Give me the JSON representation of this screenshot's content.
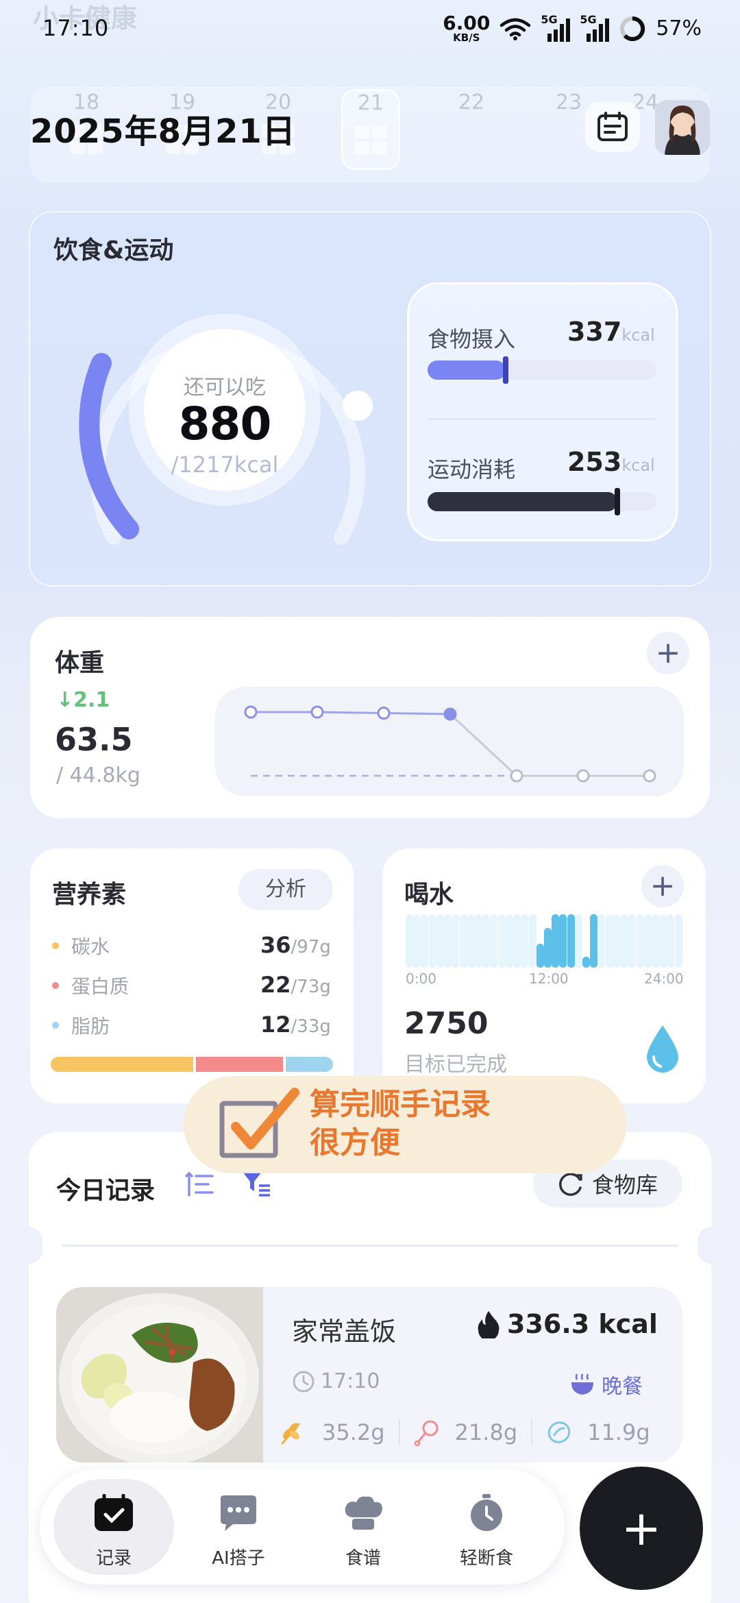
{
  "status_bar": {
    "time": "17:10",
    "net_speed": "6.00",
    "net_unit": "KB/S",
    "signal_1": "5G",
    "signal_2": "5G",
    "battery": "57%",
    "watermark": "小卡健康"
  },
  "header": {
    "date": "2025年8月21日",
    "week_days": [
      "18",
      "19",
      "20",
      "21",
      "22",
      "23",
      "24"
    ],
    "active_day": "21"
  },
  "diet": {
    "title": "饮食&运动",
    "remain_label": "还可以吃",
    "remain_value": "880",
    "remain_total": "/1217kcal",
    "food_label": "食物摄入",
    "food_value": "337",
    "food_unit": "kcal",
    "food_progress": 0.34,
    "exercise_label": "运动消耗",
    "exercise_value": "253",
    "exercise_unit": "kcal",
    "exercise_progress": 0.83,
    "colors": {
      "accent": "#7a84f2",
      "dark": "#2e3040"
    }
  },
  "weight": {
    "title": "体重",
    "change": "2.1",
    "value": "63.5",
    "target": "/ 44.8kg",
    "trend_points": [
      {
        "x": 0,
        "y": 63.6
      },
      {
        "x": 1,
        "y": 63.6
      },
      {
        "x": 2,
        "y": 63.55
      },
      {
        "x": 3,
        "y": 63.5
      },
      {
        "x": 4,
        "y": 0
      },
      {
        "x": 5,
        "y": 0
      },
      {
        "x": 6,
        "y": 0
      }
    ]
  },
  "nutrients": {
    "title": "营养素",
    "analyze_label": "分析",
    "items": [
      {
        "name": "碳水",
        "value": "36",
        "goal": "/97g",
        "color": "#f7c462"
      },
      {
        "name": "蛋白质",
        "value": "22",
        "goal": "/73g",
        "color": "#f48b8b"
      },
      {
        "name": "脂肪",
        "value": "12",
        "goal": "/33g",
        "color": "#9fd4ee"
      }
    ]
  },
  "water": {
    "title": "喝水",
    "axis_start": "0:00",
    "axis_mid": "12:00",
    "axis_end": "24:00",
    "value": "2750",
    "status": "目标已完成",
    "bar_levels": [
      0,
      0,
      0,
      0,
      0,
      0,
      0,
      0,
      0,
      0,
      0,
      0,
      0,
      0,
      0,
      0,
      0,
      0.45,
      0.75,
      1,
      1,
      1,
      0,
      0.2,
      1,
      0,
      0,
      0,
      0,
      0,
      0,
      0,
      0,
      0,
      0,
      0
    ],
    "colors": {
      "accent": "#5cc0e8",
      "idle": "#e6f4fb"
    }
  },
  "toast": {
    "line1": "算完顺手记录",
    "line2": "很方便"
  },
  "records": {
    "title": "今日记录",
    "food_library": "食物库",
    "meal": {
      "name": "家常盖饭",
      "kcal": "336.3 kcal",
      "time": "17:10",
      "type": "晚餐",
      "carb": "35.2g",
      "protein": "21.8g",
      "fat": "11.9g"
    }
  },
  "nav": {
    "items": [
      "记录",
      "AI搭子",
      "食谱",
      "轻断食"
    ],
    "active": "记录",
    "fab_label": "+"
  }
}
